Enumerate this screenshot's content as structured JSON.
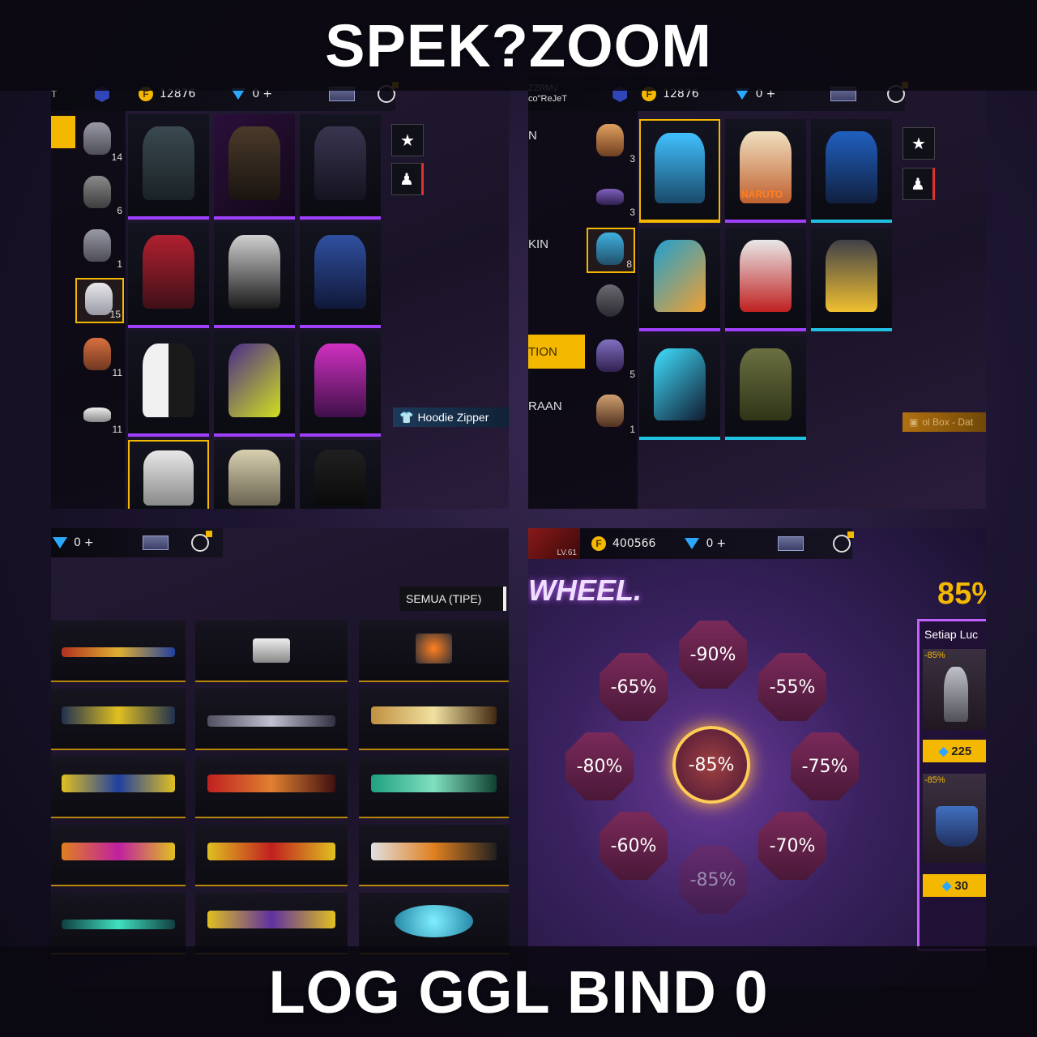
{
  "banner_top": "SPEK?ZOOM",
  "banner_bottom": "LOG GGL BIND 0",
  "panel1": {
    "partial_name": "T",
    "coins": "12876",
    "diamonds": "0",
    "plus": "+",
    "sidebar_counts": [
      "14",
      "6",
      "1",
      "15",
      "11",
      "11"
    ],
    "tag_label": "Hoodie Zipper",
    "icons": {
      "coin": "coin-icon",
      "diamond": "diamond-icon",
      "star": "star-icon",
      "mannequin": "mannequin-icon",
      "shirt": "shirt-icon"
    }
  },
  "panel2": {
    "player_name_line1": "ZZRM√",
    "player_name_line2": "co\"ReJeT",
    "coins": "12876",
    "diamonds": "0",
    "plus": "+",
    "side_labels": [
      "N",
      "KIN",
      "TION",
      "RAAN"
    ],
    "side_counts": [
      "3",
      "3",
      "8",
      "5",
      "1"
    ],
    "grid_labels": [
      "NARUTO"
    ],
    "partial_tag": "ol Box - Dat"
  },
  "panel3": {
    "diamonds": "0",
    "plus": "+",
    "filter_label": "SEMUA (TIPE)"
  },
  "panel4": {
    "level": "LV.61",
    "coins": "400566",
    "diamonds": "0",
    "plus": "+",
    "title": "WHEEL.",
    "headline_discount": "85%",
    "discounts": [
      "-90%",
      "-55%",
      "-75%",
      "-70%",
      "-85%",
      "-60%",
      "-80%",
      "-65%"
    ],
    "center_discount": "-85%",
    "offer_header": "Setiap Luc",
    "offer_items": [
      {
        "discount": "-85%",
        "price": "225"
      },
      {
        "discount": "-85%",
        "price": "30"
      }
    ]
  }
}
